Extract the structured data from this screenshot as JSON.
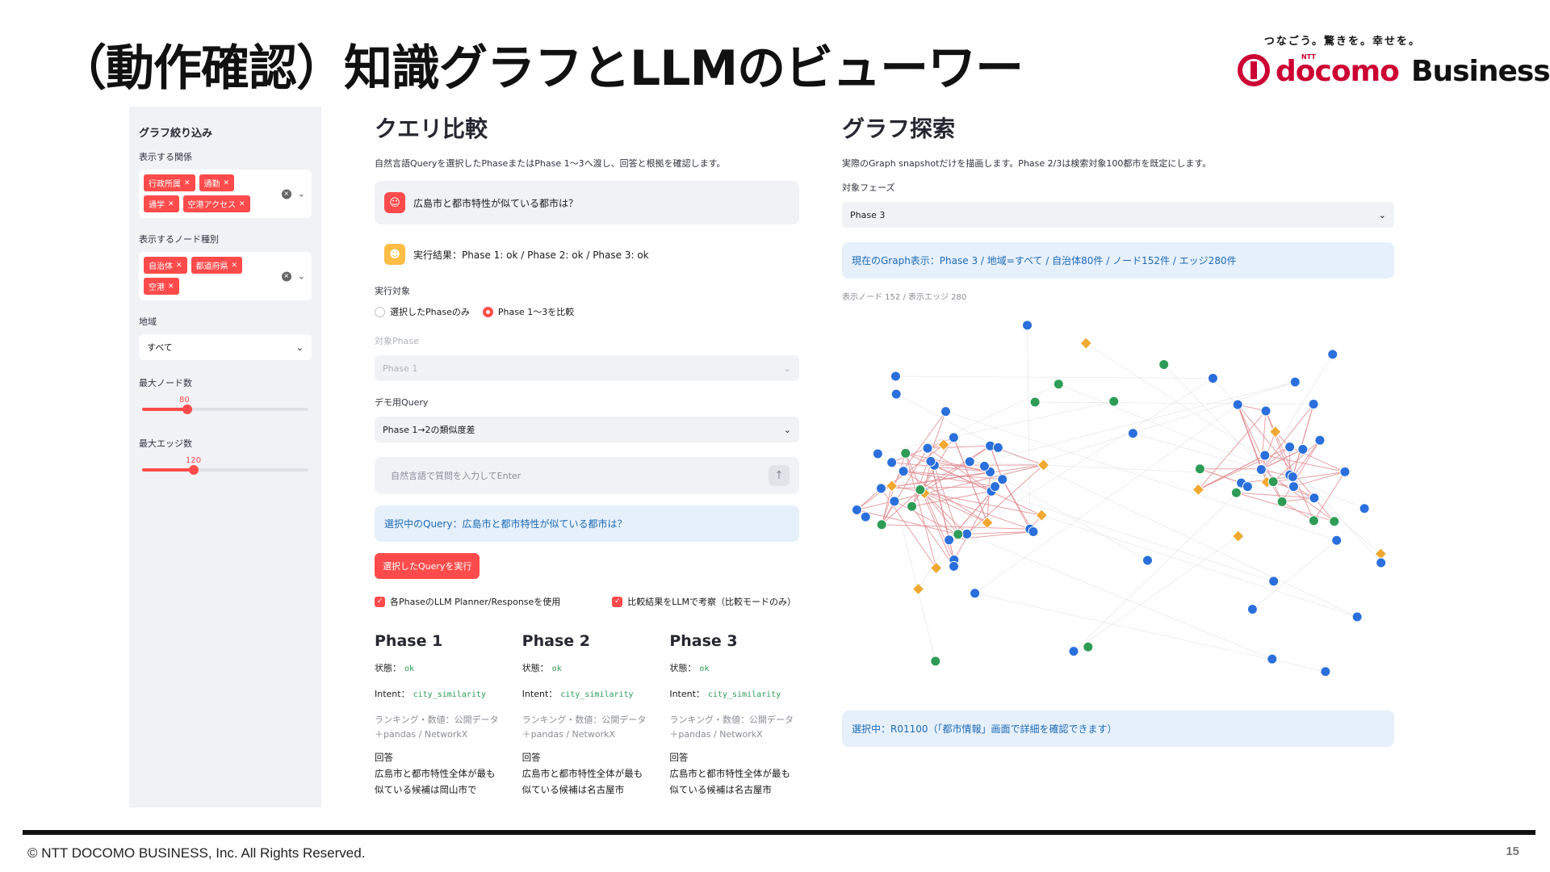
{
  "slide": {
    "title": "（動作確認）知識グラフとLLMのビューワー",
    "copyright": "© NTT DOCOMO BUSINESS, Inc. All Rights Reserved.",
    "page_number": "15"
  },
  "logo": {
    "tagline": "つなごう。驚きを。幸せを。",
    "ntt": "NTT",
    "docomo": "docomo",
    "business": "Business",
    "color": "#cc0033"
  },
  "sidebar": {
    "heading": "グラフ絞り込み",
    "relations_label": "表示する関係",
    "relations": [
      "行政所属",
      "通勤",
      "通学",
      "空港アクセス"
    ],
    "node_types_label": "表示するノード種別",
    "node_types": [
      "自治体",
      "都道府県",
      "空港"
    ],
    "region_label": "地域",
    "region_value": "すべて",
    "max_nodes_label": "最大ノード数",
    "max_nodes_value": "80",
    "max_nodes_level": 0.27,
    "max_edges_label": "最大エッジ数",
    "max_edges_value": "120",
    "max_edges_level": 0.31
  },
  "query": {
    "title": "クエリ比較",
    "caption": "自然言語Queryを選択したPhaseまたはPhase 1〜3へ渡し、回答と根拠を確認します。",
    "user_message": "広島市と都市特性が似ている都市は？",
    "result_message": "実行結果：Phase 1: ok / Phase 2: ok / Phase 3: ok",
    "target_label": "実行対象",
    "radio_selected_only": "選択したPhaseのみ",
    "radio_compare": "Phase 1〜3を比較",
    "phase_select_label": "対象Phase",
    "phase_select_value": "Phase 1",
    "demo_query_label": "デモ用Query",
    "demo_query_value": "Phase 1→2の類似度差",
    "input_placeholder": "自然言語で質問を入力してEnter",
    "selected_query": "選択中のQuery：広島市と都市特性が似ている都市は？",
    "run_button": "選択したQueryを実行",
    "check_llm": "各PhaseのLLM Planner/Responseを使用",
    "check_compare": "比較結果をLLMで考察（比較モードのみ）",
    "accent": "#ff4b4b"
  },
  "phases": [
    {
      "title": "Phase 1",
      "status_label": "状態：",
      "status": "ok",
      "intent_label": "Intent：",
      "intent": "city_similarity",
      "method": "ランキング・数値：公開データ＋pandas / NetworkX",
      "answer_label": "回答",
      "answer": "広島市と都市特性全体が最も似ている候補は岡山市で"
    },
    {
      "title": "Phase 2",
      "status_label": "状態：",
      "status": "ok",
      "intent_label": "Intent：",
      "intent": "city_similarity",
      "method": "ランキング・数値：公開データ＋pandas / NetworkX",
      "answer_label": "回答",
      "answer": "広島市と都市特性全体が最も似ている候補は名古屋市"
    },
    {
      "title": "Phase 3",
      "status_label": "状態：",
      "status": "ok",
      "intent_label": "Intent：",
      "intent": "city_similarity",
      "method": "ランキング・数値：公開データ＋pandas / NetworkX",
      "answer_label": "回答",
      "answer": "広島市と都市特性全体が最も似ている候補は名古屋市"
    }
  ],
  "graph": {
    "title": "グラフ探索",
    "caption": "実際のGraph snapshotだけを描画します。Phase 2/3は検索対象100都市を既定にします。",
    "phase_label": "対象フェーズ",
    "phase_value": "Phase 3",
    "info": "現在のGraph表示：Phase 3 / 地域=すべて / 自治体80件 / ノード152件 / エッジ280件",
    "count": "表示ノード 152 / 表示エッジ 280",
    "selected": "選択中：R01100（「都市情報」画面で詳細を確認できます）",
    "colors": {
      "municipality": "#2a6fdb",
      "prefecture": "#2e9c56",
      "airport": "#f0a830",
      "edge": "#e08a8f"
    }
  }
}
